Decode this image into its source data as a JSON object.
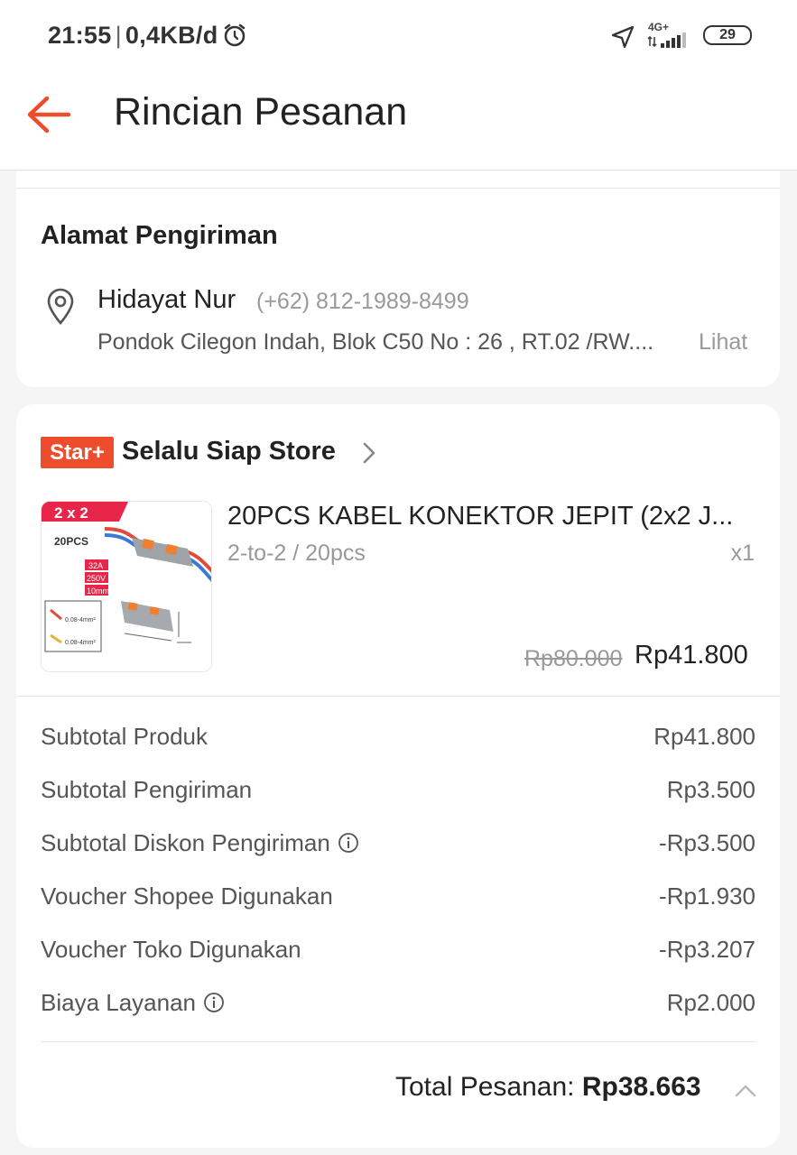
{
  "status_bar": {
    "time": "21:55",
    "separator": "|",
    "data_rate": "0,4KB/d",
    "network_label": "4G+",
    "battery": "29"
  },
  "header": {
    "title": "Rincian Pesanan"
  },
  "address": {
    "section_title": "Alamat Pengiriman",
    "name": "Hidayat Nur",
    "phone": "(+62) 812-1989-8499",
    "line": "Pondok Cilegon Indah, Blok C50 No : 26 , RT.02 /RW....",
    "view_label": "Lihat"
  },
  "store": {
    "badge": "Star+",
    "name": "Selalu Siap Store"
  },
  "product": {
    "name": "20PCS KABEL KONEKTOR JEPIT (2x2 J...",
    "variant": "2-to-2 / 20pcs",
    "quantity": "x1",
    "original_price": "Rp80.000",
    "price": "Rp41.800",
    "image_text": {
      "combo": "2 x 2",
      "pcs": "20PCS",
      "spec_1": "32A",
      "spec_2": "250V",
      "spec_3": "10mm",
      "wire_1": "0.08-4mm²",
      "wire_2": "0.08-4mm²"
    }
  },
  "summary": {
    "rows": [
      {
        "label": "Subtotal Produk",
        "value": "Rp41.800"
      },
      {
        "label": "Subtotal Pengiriman",
        "value": "Rp3.500"
      },
      {
        "label": "Subtotal Diskon Pengiriman",
        "value": "-Rp3.500"
      },
      {
        "label": "Voucher Shopee Digunakan",
        "value": "-Rp1.930"
      },
      {
        "label": "Voucher Toko Digunakan",
        "value": "-Rp3.207"
      },
      {
        "label": "Biaya Layanan",
        "value": "Rp2.000"
      }
    ],
    "total_label": "Total Pesanan:",
    "total_value": "Rp38.663"
  },
  "colors": {
    "accent": "#ee4d2d",
    "text": "#222222",
    "muted": "#999999"
  }
}
